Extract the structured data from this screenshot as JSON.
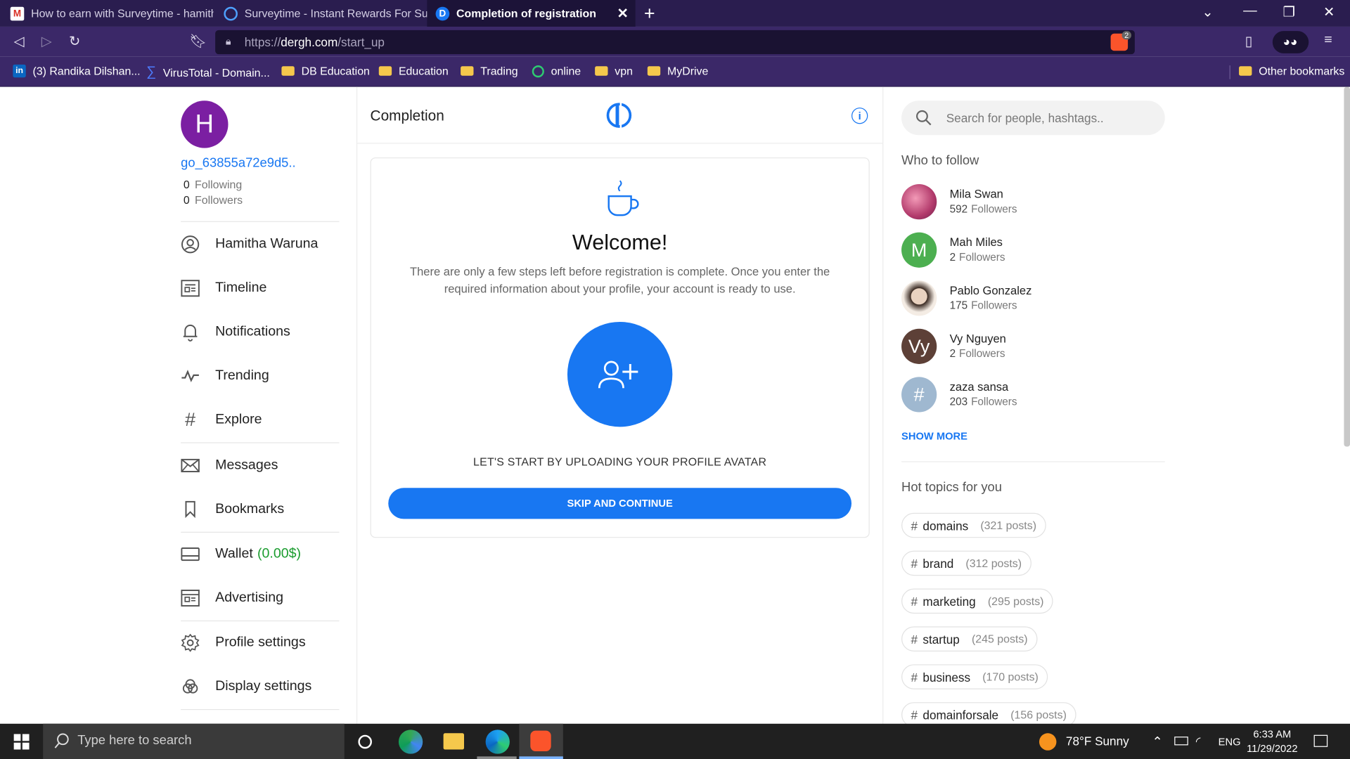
{
  "browser": {
    "tabs": [
      {
        "title": "How to earn with Surveytime - hamith"
      },
      {
        "title": "Surveytime - Instant Rewards For Surve"
      },
      {
        "title": "Completion of registration"
      }
    ],
    "url_prefix": "https://",
    "url_domain": "dergh.com",
    "url_path": "/start_up",
    "shield_count": "2",
    "bookmarks": [
      {
        "label": "(3) Randika Dilshan..."
      },
      {
        "label": "VirusTotal - Domain..."
      },
      {
        "label": "DB Education"
      },
      {
        "label": "Education"
      },
      {
        "label": "Trading"
      },
      {
        "label": "online"
      },
      {
        "label": "vpn"
      },
      {
        "label": "MyDrive"
      }
    ],
    "other_bookmarks": "Other bookmarks"
  },
  "profile": {
    "avatar_letter": "H",
    "username": "go_63855a72e9d5..",
    "following_count": "0",
    "following_label": "Following",
    "followers_count": "0",
    "followers_label": "Followers"
  },
  "nav": {
    "name": "Hamitha Waruna",
    "timeline": "Timeline",
    "notifications": "Notifications",
    "trending": "Trending",
    "explore": "Explore",
    "messages": "Messages",
    "bookmarks": "Bookmarks",
    "wallet": "Wallet",
    "wallet_amount": "(0.00$)",
    "advertising": "Advertising",
    "profile_settings": "Profile settings",
    "display_settings": "Display settings"
  },
  "center": {
    "title": "Completion",
    "welcome": "Welcome!",
    "description": "There are only a few steps left before registration is complete. Once you enter the required information about your profile, your account is ready to use.",
    "upload_prompt": "LET'S START BY UPLOADING YOUR PROFILE AVATAR",
    "skip_button": "SKIP AND CONTINUE"
  },
  "right": {
    "search_placeholder": "Search for people, hashtags..",
    "who_to_follow": "Who to follow",
    "followers_label": "Followers",
    "people": [
      {
        "name": "Mila Swan",
        "followers": "592",
        "avatar": "photo"
      },
      {
        "name": "Mah Miles",
        "followers": "2",
        "avatar": "M"
      },
      {
        "name": "Pablo Gonzalez",
        "followers": "175",
        "avatar": "photo"
      },
      {
        "name": "Vy Nguyen",
        "followers": "2",
        "avatar": "Vy"
      },
      {
        "name": "zaza sansa",
        "followers": "203",
        "avatar": "#"
      }
    ],
    "show_more": "SHOW MORE",
    "hot_topics": "Hot topics for you",
    "topics": [
      {
        "tag": "domains",
        "posts": "(321 posts)"
      },
      {
        "tag": "brand",
        "posts": "(312 posts)"
      },
      {
        "tag": "marketing",
        "posts": "(295 posts)"
      },
      {
        "tag": "startup",
        "posts": "(245 posts)"
      },
      {
        "tag": "business",
        "posts": "(170 posts)"
      },
      {
        "tag": "domainforsale",
        "posts": "(156 posts)"
      }
    ]
  },
  "taskbar": {
    "search_placeholder": "Type here to search",
    "weather": "78°F  Sunny",
    "language": "ENG",
    "time": "6:33 AM",
    "date": "11/29/2022"
  },
  "colors": {
    "accent": "#1877f2",
    "wallet": "#1a9c2e",
    "avatar_h": "#7b1fa2",
    "tabbar": "#2a1d4f",
    "toolbar": "#3b2868"
  }
}
